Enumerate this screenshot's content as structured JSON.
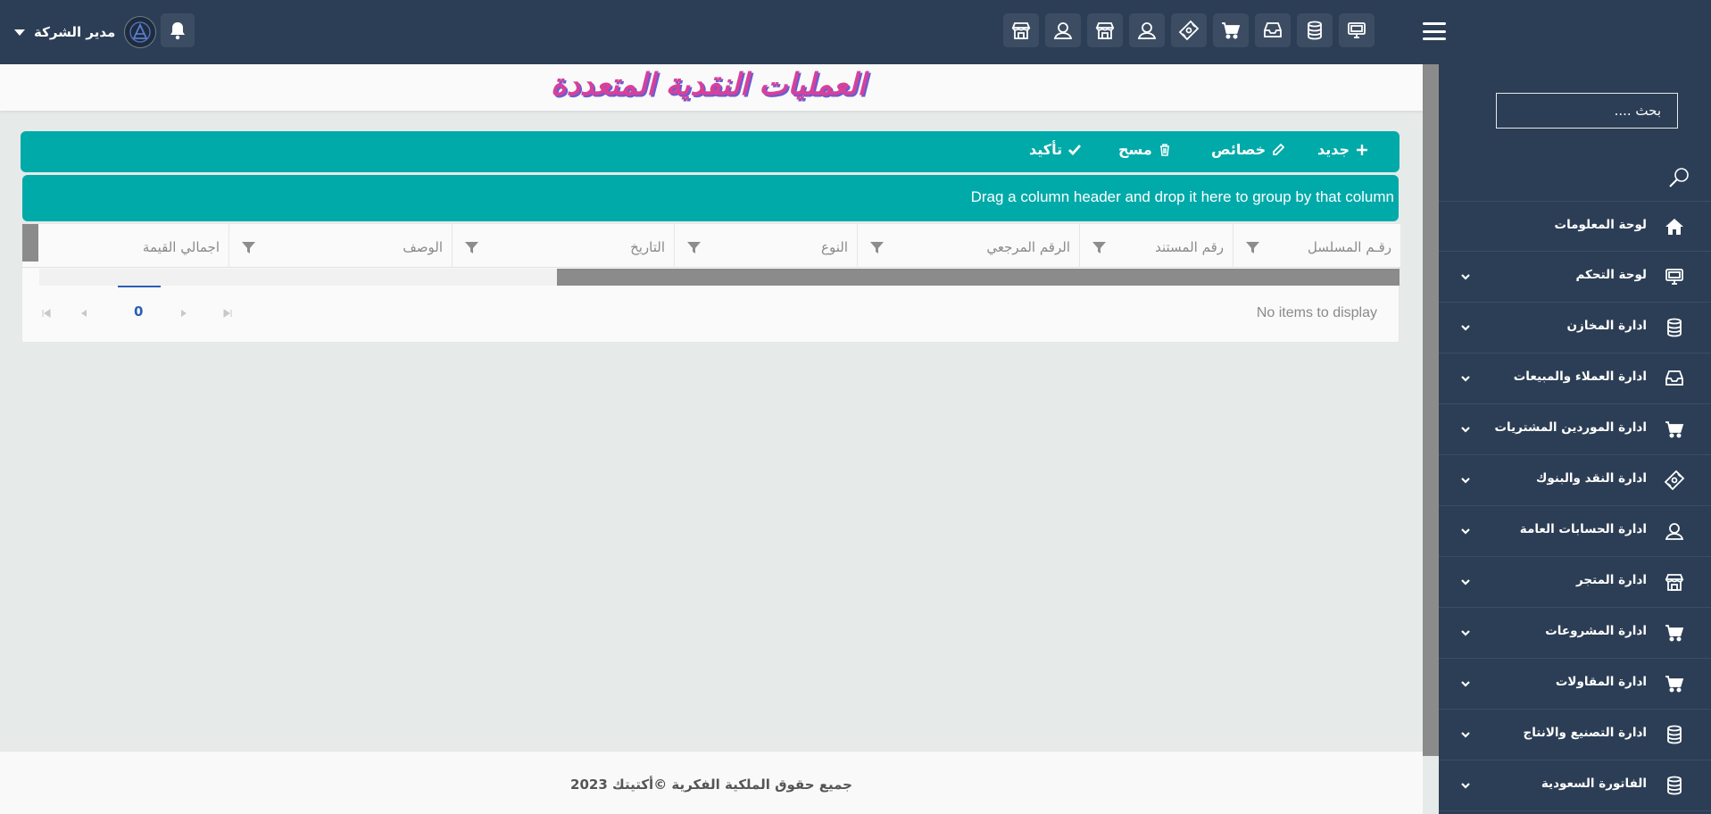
{
  "header": {
    "user_name": "مدير الشركة",
    "top_icons": [
      "monitor-icon",
      "database-icon",
      "inbox-icon",
      "cart-icon",
      "money-icon",
      "user-icon",
      "store-icon",
      "user-icon",
      "store-icon"
    ]
  },
  "sidebar": {
    "search_placeholder": "بحث ....",
    "items": [
      {
        "label": "لوحة المعلومات",
        "icon": "home-icon",
        "has_submenu": false
      },
      {
        "label": "لوحة التحكم",
        "icon": "monitor-icon",
        "has_submenu": true
      },
      {
        "label": "ادارة المخازن",
        "icon": "database-icon",
        "has_submenu": true
      },
      {
        "label": "ادارة العملاء والمبيعات",
        "icon": "inbox-icon",
        "has_submenu": true
      },
      {
        "label": "ادارة الموردين المشتريات",
        "icon": "cart-icon",
        "has_submenu": true
      },
      {
        "label": "ادارة النقد والبنوك",
        "icon": "money-icon",
        "has_submenu": true
      },
      {
        "label": "ادارة الحسابات العامة",
        "icon": "user-icon",
        "has_submenu": true
      },
      {
        "label": "ادارة المتجر",
        "icon": "store-icon",
        "has_submenu": true
      },
      {
        "label": "ادارة المشروعات",
        "icon": "cart-icon",
        "has_submenu": true
      },
      {
        "label": "ادارة المقاولات",
        "icon": "cart-icon",
        "has_submenu": true
      },
      {
        "label": "ادارة التصنيع والانتاج",
        "icon": "database-icon",
        "has_submenu": true
      },
      {
        "label": "الفاتورة السعودية",
        "icon": "database-icon",
        "has_submenu": true
      }
    ]
  },
  "page": {
    "title": "العمليات النقدية المتعددة"
  },
  "toolbar": {
    "new_label": "جديد",
    "properties_label": "خصائص",
    "delete_label": "مسح",
    "confirm_label": "تأكيد"
  },
  "grid": {
    "group_hint": "Drag a column header and drop it here to group by that column",
    "columns": [
      "رقـم المسلسل",
      "رقم المستند",
      "الرقم المرجعي",
      "النوع",
      "التاريخ",
      "الوصف",
      "اجمالي القيمة"
    ],
    "rows": [],
    "empty_text": "No items to display",
    "current_page": "0"
  },
  "footer": {
    "copyright": "جميع حقوق الملكية الفكرية ©أكتيتك 2023"
  },
  "colors": {
    "topbar": "#2c3e55",
    "accent_teal": "#00aaa9",
    "title_pink": "#d8409a",
    "title_shadow": "#6a5cd1"
  }
}
